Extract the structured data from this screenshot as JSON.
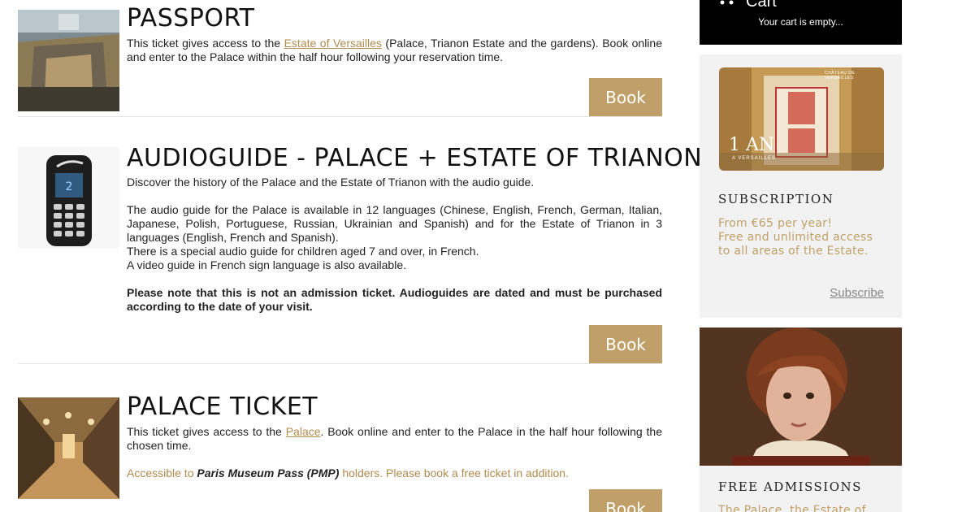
{
  "products": [
    {
      "title": "PASSPORT",
      "desc_before": "This ticket gives access to the ",
      "desc_link": "Estate of Versailles",
      "desc_after": " (Palace, Trianon Estate and the gardens). Book online and enter to the Palace within the half hour following your reservation time.",
      "book_label": "Book"
    },
    {
      "title": "AUDIOGUIDE - PALACE + ESTATE OF TRIANON",
      "intro": "Discover the history of the Palace and the Estate of Trianon with the audio guide.",
      "para1": "The audio guide for the Palace is available in 12 languages (Chinese, English, French, German, Italian, Japanese, Polish, Portuguese, Russian, Ukrainian and Spanish) and for the Estate of Trianon in 3 languages (English, French and Spanish).",
      "para2": "There is a special audio guide for children aged 7 and over, in French.",
      "para3": "A video guide in French sign language is also available.",
      "note": "Please note that this is not an admission ticket. Audioguides are dated and must be purchased according to the date of your visit.",
      "book_label": "Book"
    },
    {
      "title": "PALACE TICKET",
      "desc_before": "This ticket gives access to the ",
      "desc_link": "Palace",
      "desc_after": ". Book online and enter to the Palace in the half hour following the chosen time.",
      "pmp_before": "Accessible to ",
      "pmp_bold": "Paris Museum Pass (PMP)",
      "pmp_after": " holders. Please book a free ticket in addition.",
      "book_label": "Book"
    }
  ],
  "cart": {
    "title": "Cart",
    "empty_text": "Your cart is empty..."
  },
  "subscription": {
    "card_text": "1 AN",
    "card_sub": "A VERSAILLES",
    "card_top": "CHÂTEAU DE VERSAILLES",
    "title": "SUBSCRIPTION",
    "price_line": "From €65 per year!",
    "desc": "Free and unlimited access to all areas of the Estate.",
    "link": "Subscribe"
  },
  "free_admissions": {
    "title": "FREE ADMISSIONS",
    "text": "The Palace, the Estate of"
  },
  "colors": {
    "accent": "#c0a068",
    "link": "#b08b4f",
    "cart_bg": "#000000",
    "sidebar_bg": "#f2f2f2"
  }
}
